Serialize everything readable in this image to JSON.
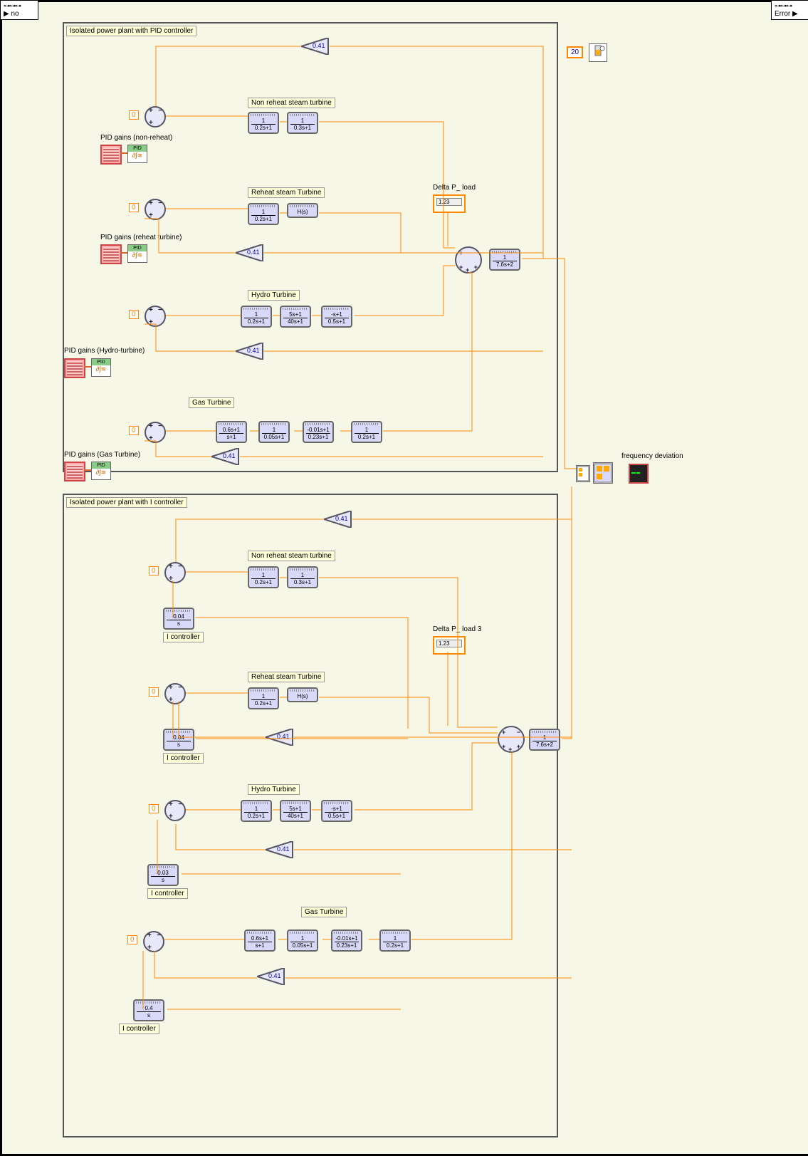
{
  "terminals": {
    "left_label": "no",
    "right_label": "Error"
  },
  "timer_value": "20",
  "output_label": "frequency deviation",
  "pid_section": {
    "title": "Isolated power plant with PID controller",
    "gains": {
      "nonreheat": "PID gains (non-reheat)",
      "reheat": "PID gains (reheat turbine)",
      "hydro": "PID gains (Hydro-turbine)",
      "gas": "PID gains (Gas Turbine)"
    },
    "load_label": "Delta P_ load",
    "load_value": "1.23",
    "feedback_gain": "0.41",
    "branches": {
      "nonreheat": {
        "label": "Non reheat steam turbine",
        "tf": [
          {
            "num": "1",
            "den": "0.2s+1"
          },
          {
            "num": "1",
            "den": "0.3s+1"
          }
        ]
      },
      "reheat": {
        "label": "Reheat steam Turbine",
        "tf": [
          {
            "num": "1",
            "den": "0.2s+1"
          },
          {
            "num": "",
            "den": "H(s)"
          }
        ]
      },
      "hydro": {
        "label": "Hydro Turbine",
        "tf": [
          {
            "num": "1",
            "den": "0.2s+1"
          },
          {
            "num": "5s+1",
            "den": "40s+1"
          },
          {
            "num": "-s+1",
            "den": "0.5s+1"
          }
        ]
      },
      "gas": {
        "label": "Gas Turbine",
        "tf": [
          {
            "num": "0.6s+1",
            "den": "s+1"
          },
          {
            "num": "1",
            "den": "0.05s+1"
          },
          {
            "num": "-0.01s+1",
            "den": "0.23s+1"
          },
          {
            "num": "1",
            "den": "0.2s+1"
          }
        ]
      }
    },
    "plant_tf": {
      "num": "1",
      "den": "7.6s+2"
    }
  },
  "i_section": {
    "title": "Isolated power plant with I controller",
    "ctrl_label": "I controller",
    "load_label": "Delta P_ load 3",
    "load_value": "1.23",
    "feedback_gain": "0.41",
    "branches": {
      "nonreheat": {
        "label": "Non reheat steam turbine",
        "i_tf": {
          "num": "0.04",
          "den": "s"
        },
        "tf": [
          {
            "num": "1",
            "den": "0.2s+1"
          },
          {
            "num": "1",
            "den": "0.3s+1"
          }
        ]
      },
      "reheat": {
        "label": "Reheat steam Turbine",
        "i_tf": {
          "num": "0.04",
          "den": "s"
        },
        "tf": [
          {
            "num": "1",
            "den": "0.2s+1"
          },
          {
            "num": "",
            "den": "H(s)"
          }
        ]
      },
      "hydro": {
        "label": "Hydro Turbine",
        "i_tf": {
          "num": "0.03",
          "den": "s"
        },
        "tf": [
          {
            "num": "1",
            "den": "0.2s+1"
          },
          {
            "num": "5s+1",
            "den": "40s+1"
          },
          {
            "num": "-s+1",
            "den": "0.5s+1"
          }
        ]
      },
      "gas": {
        "label": "Gas Turbine",
        "i_tf": {
          "num": "0.4",
          "den": "s"
        },
        "tf": [
          {
            "num": "0.6s+1",
            "den": "s+1"
          },
          {
            "num": "1",
            "den": "0.05s+1"
          },
          {
            "num": "-0.01s+1",
            "den": "0.23s+1"
          },
          {
            "num": "1",
            "den": "0.2s+1"
          }
        ]
      }
    },
    "plant_tf": {
      "num": "1",
      "den": "7.6s+2"
    }
  },
  "zero": "0",
  "pid_badge": "PID"
}
